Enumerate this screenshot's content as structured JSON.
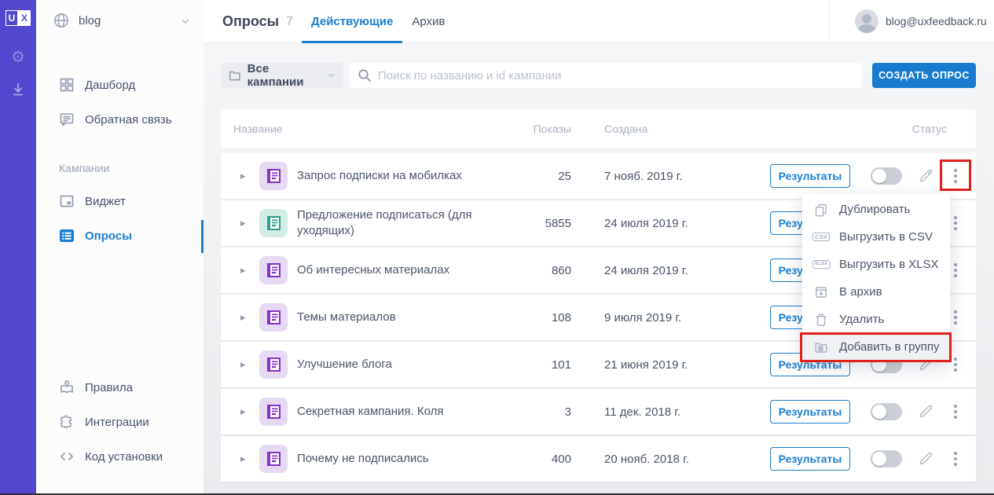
{
  "colors": {
    "rail_purple": "#5347cf",
    "accent_blue": "#1b7ed0",
    "button_blue": "#187bcd",
    "annotation_red": "#e0211a",
    "icon_purple": "#8530c9",
    "icon_purple_bg": "#e6d9f4",
    "icon_teal": "#2aa08c",
    "icon_teal_bg": "#d2ece6"
  },
  "rail": {
    "logo_u": "U",
    "logo_x": "X"
  },
  "workspace": {
    "name": "blog"
  },
  "sidebar": {
    "dashboard": "Дашборд",
    "feedback": "Обратная связь",
    "section": "Кампании",
    "widget": "Виджет",
    "surveys": "Опросы",
    "rules": "Правила",
    "integrations": "Интеграции",
    "install_code": "Код установки"
  },
  "topbar": {
    "title": "Опросы",
    "count": "7",
    "tab_active": "Действующие",
    "tab_archive": "Архив",
    "account": "blog@uxfeedback.ru"
  },
  "filters": {
    "campaigns": "Все кампании",
    "search_placeholder": "Поиск по названию и id кампании",
    "create": "СОЗДАТЬ ОПРОС"
  },
  "table": {
    "col_name": "Название",
    "col_views": "Показы",
    "col_created": "Создана",
    "col_status": "Статус",
    "results_label": "Результаты",
    "rows": [
      {
        "title": "Запрос подписки на мобилках",
        "views": "25",
        "created": "7 нояб. 2019 г."
      },
      {
        "title": "Предложение подписаться (для уходящих)",
        "views": "5855",
        "created": "24 июля 2019 г."
      },
      {
        "title": "Об интересных материалах",
        "views": "860",
        "created": "24 июля 2019 г."
      },
      {
        "title": "Темы материалов",
        "views": "108",
        "created": "9 июля 2019 г."
      },
      {
        "title": "Улучшение блога",
        "views": "101",
        "created": "21 июня 2019 г."
      },
      {
        "title": "Секретная кампания. Коля",
        "views": "3",
        "created": "11 дек. 2018 г."
      },
      {
        "title": "Почему не подписались",
        "views": "400",
        "created": "20 нояб. 2018 г."
      }
    ]
  },
  "menu": {
    "items": [
      {
        "label": "Дублировать"
      },
      {
        "label": "Выгрузить в CSV",
        "badge": "CSV"
      },
      {
        "label": "Выгрузить в XLSX",
        "badge": "XLSX"
      },
      {
        "label": "В архив"
      },
      {
        "label": "Удалить"
      },
      {
        "label": "Добавить в группу"
      }
    ]
  }
}
